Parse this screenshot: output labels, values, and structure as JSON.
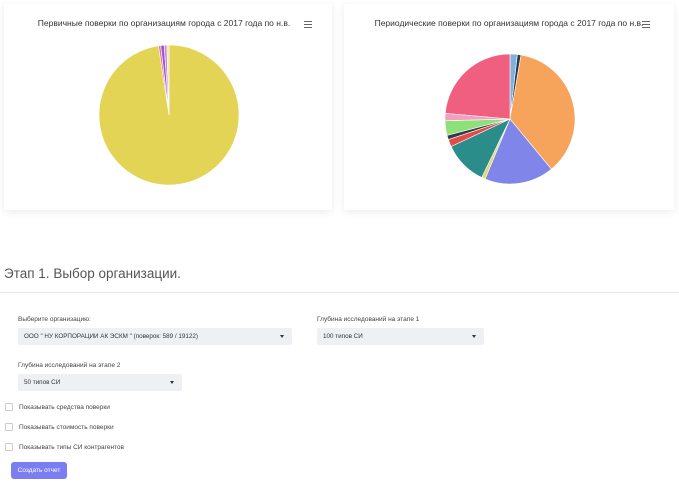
{
  "charts": {
    "primary": {
      "title": "Первичные поверки по организациям города с 2017 года по н.в."
    },
    "periodic": {
      "title": "Периодические поверки по организациям города с 2017 года по н.в."
    }
  },
  "chart_data": [
    {
      "type": "pie",
      "title": "Первичные поверки по организациям города с 2017 года по н.в.",
      "slices": [
        {
          "value": 97.6,
          "color": "#e3d456"
        },
        {
          "value": 0.5,
          "color": "#e86fa0"
        },
        {
          "value": 0.8,
          "color": "#9b59d0"
        },
        {
          "value": 0.6,
          "color": "#c78ad8"
        },
        {
          "value": 0.5,
          "color": "#f0e2a0"
        }
      ]
    },
    {
      "type": "pie",
      "title": "Периодические поверки по организациям города с 2017 года по н.в.",
      "slices": [
        {
          "value": 2.0,
          "color": "#7fb0de"
        },
        {
          "value": 1.0,
          "color": "#2d3a4a"
        },
        {
          "value": 40.0,
          "color": "#f6a45c"
        },
        {
          "value": 19.0,
          "color": "#8085ea"
        },
        {
          "value": 1.0,
          "color": "#e4d66a"
        },
        {
          "value": 12.0,
          "color": "#2a8d8a"
        },
        {
          "value": 2.0,
          "color": "#e44a4a"
        },
        {
          "value": 1.2,
          "color": "#333b44"
        },
        {
          "value": 4.0,
          "color": "#8ee07b"
        },
        {
          "value": 2.0,
          "color": "#f59fc0"
        },
        {
          "value": 26.0,
          "color": "#f15f80"
        }
      ]
    }
  ],
  "stage": {
    "title": "Этап 1. Выбор организации."
  },
  "form": {
    "org_label": "Выберите организацию:",
    "org_value": "ООО \" НУ КОРПОРАЦИИ АК ЭСКМ \" (поверок: 589 / 19122)",
    "depth1_label": "Глубина исследований на этапе 1",
    "depth1_value": "100 типов СИ",
    "depth2_label": "Глубина исследований на этапе 2",
    "depth2_value": "50 типов СИ",
    "checkboxes": [
      {
        "label": "Показывать средства поверки",
        "checked": false
      },
      {
        "label": "Показывать стоимость поверки",
        "checked": false
      },
      {
        "label": "Показывать типы СИ контрагентов",
        "checked": false
      }
    ],
    "submit_label": "Создать отчет"
  }
}
